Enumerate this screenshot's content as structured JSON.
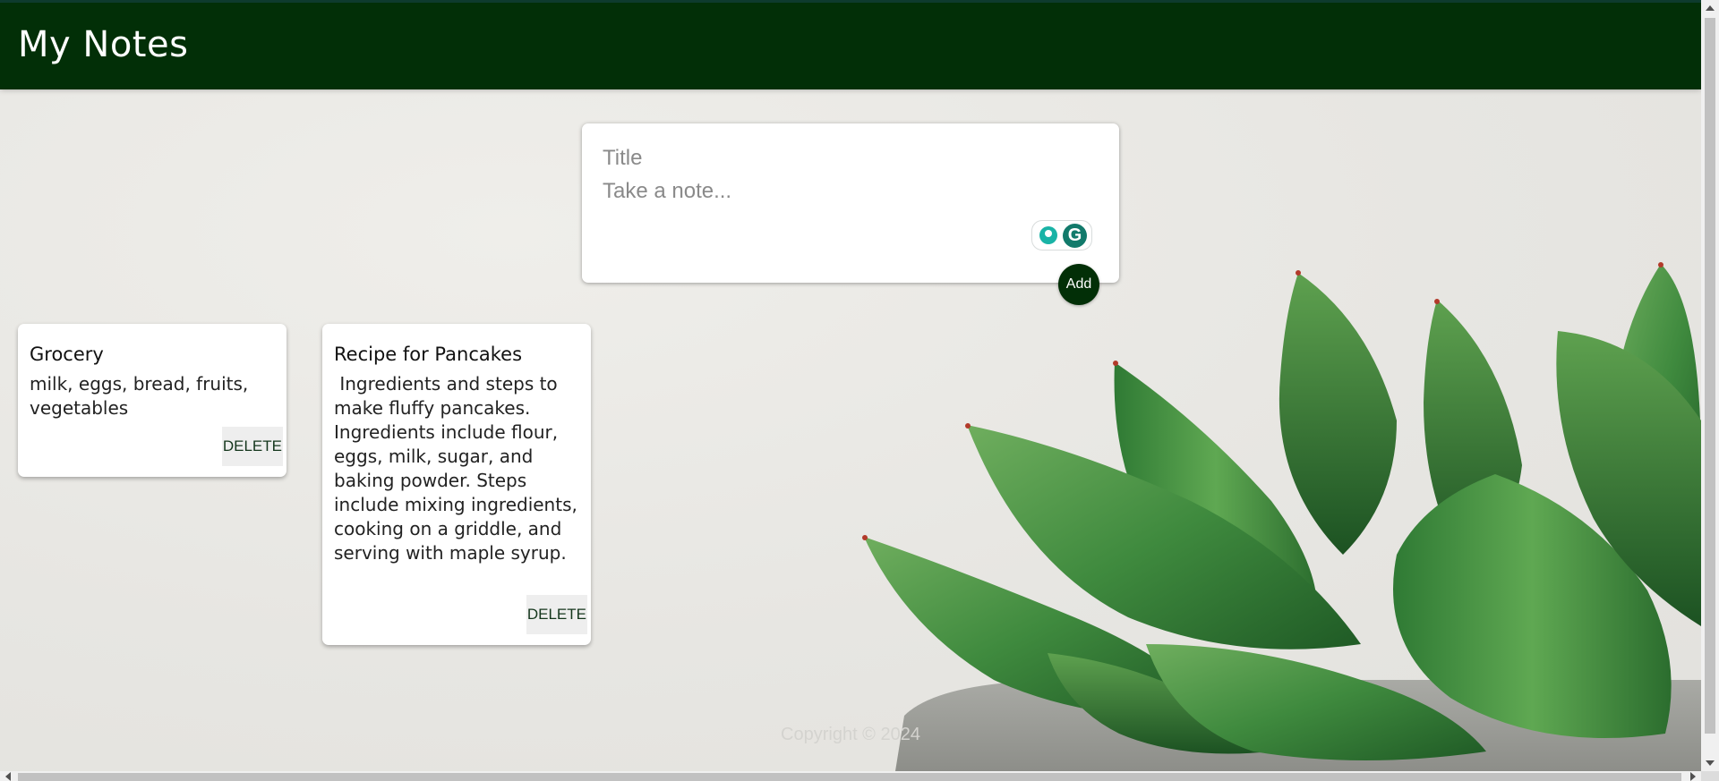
{
  "header": {
    "title": "My Notes"
  },
  "create_area": {
    "title_placeholder": "Title",
    "content_placeholder": "Take a note...",
    "add_label": "Add",
    "grammarly_icon": "G"
  },
  "notes": [
    {
      "title": "Grocery",
      "content": "milk, eggs, bread, fruits, vegetables",
      "delete_label": "DELETE"
    },
    {
      "title": "Recipe for Pancakes",
      "content": " Ingredients and steps to make fluffy pancakes. Ingredients include flour, eggs, milk, sugar, and baking powder. Steps include mixing ingredients, cooking on a griddle, and serving with maple syrup.",
      "delete_label": "DELETE"
    }
  ],
  "footer": {
    "text": "Copyright © 2024"
  },
  "colors": {
    "header_bg": "#022f07",
    "add_button": "#022f07",
    "background": "#e8e7e3"
  }
}
